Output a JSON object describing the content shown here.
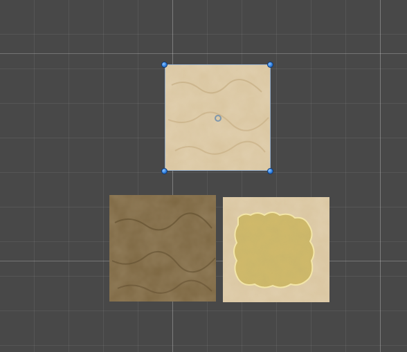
{
  "scene": {
    "background_color": "#484848",
    "grid_color": "rgba(255,255,255,0.07)",
    "axis_color": "rgba(200,200,200,0.35)"
  },
  "sprites": [
    {
      "name": "sand-sprite-selected",
      "tone": "light-sand",
      "selected": true
    },
    {
      "name": "sand-sprite-dark",
      "tone": "dark-sand",
      "selected": false
    },
    {
      "name": "sand-sprite-with-gold-patch",
      "tone": "light-sand-gold-patch",
      "selected": false
    }
  ],
  "colors": {
    "light_sand": "#d8c198",
    "dark_sand": "#7a6440",
    "gold_patch": "#c9b060",
    "handle_blue": "#2d7fe0"
  },
  "icons": {
    "pivot": "pivot-circle-icon",
    "handle": "resize-handle-icon"
  }
}
